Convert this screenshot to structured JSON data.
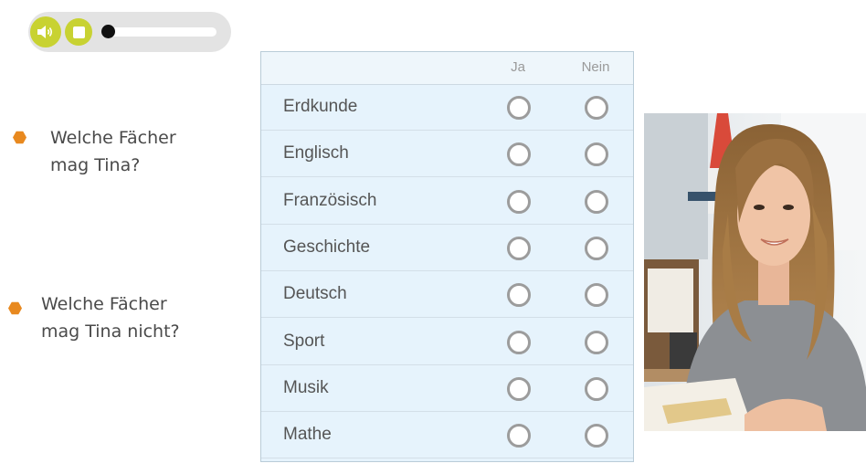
{
  "audio_player": {
    "sound_icon": "speaker-icon",
    "stop_icon": "stop-icon",
    "progress": 0.0,
    "colors": {
      "button": "#c8d232",
      "bar": "#e3e3e3",
      "knob": "#111111"
    }
  },
  "questions": [
    {
      "lines": [
        "Welche Fächer",
        "mag Tina?"
      ]
    },
    {
      "lines": [
        "Welche Fächer",
        "mag Tina nicht?"
      ]
    }
  ],
  "table": {
    "headers": {
      "subject": "",
      "yes": "Ja",
      "no": "Nein"
    },
    "rows": [
      {
        "subject": "Erdkunde"
      },
      {
        "subject": "Englisch"
      },
      {
        "subject": "Französisch"
      },
      {
        "subject": "Geschichte"
      },
      {
        "subject": "Deutsch"
      },
      {
        "subject": "Sport"
      },
      {
        "subject": "Musik"
      },
      {
        "subject": "Mathe"
      }
    ]
  },
  "photo": {
    "description_icon": "student-photo"
  },
  "colors": {
    "accent": "#e8891f",
    "table_bg": "#e6f3fc"
  }
}
